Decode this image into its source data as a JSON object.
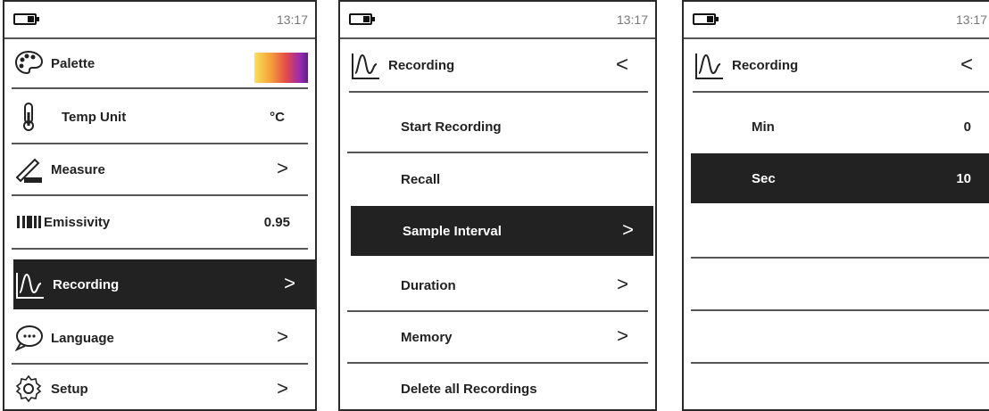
{
  "status": {
    "time": "13:17"
  },
  "screen1": {
    "items": [
      {
        "label": "Palette",
        "value": "",
        "icon": "palette-icon"
      },
      {
        "label": "Temp Unit",
        "value": "°C",
        "icon": "thermometer-icon"
      },
      {
        "label": "Measure",
        "value": ">",
        "icon": "measure-icon"
      },
      {
        "label": "Emissivity",
        "value": "0.95",
        "icon": "emissivity-icon"
      },
      {
        "label": "Recording",
        "value": ">",
        "icon": "recording-icon"
      },
      {
        "label": "Language",
        "value": ">",
        "icon": "language-icon"
      },
      {
        "label": "Setup",
        "value": ">",
        "icon": "gear-icon"
      }
    ],
    "selected": "Recording"
  },
  "screen2": {
    "header": {
      "title": "Recording",
      "back": "<"
    },
    "items": [
      {
        "label": "Start Recording",
        "value": ""
      },
      {
        "label": "Recall",
        "value": ""
      },
      {
        "label": "Sample Interval",
        "value": ">"
      },
      {
        "label": "Duration",
        "value": ">"
      },
      {
        "label": "Memory",
        "value": ">"
      },
      {
        "label": "Delete all Recordings",
        "value": ""
      }
    ],
    "selected": "Sample Interval"
  },
  "screen3": {
    "header": {
      "title": "Recording",
      "back": "<"
    },
    "items": [
      {
        "label": "Min",
        "value": "0"
      },
      {
        "label": "Sec",
        "value": "10"
      }
    ],
    "selected": "Sec"
  },
  "colors": {
    "selected_bg": "#222222",
    "divider": "#555555"
  }
}
